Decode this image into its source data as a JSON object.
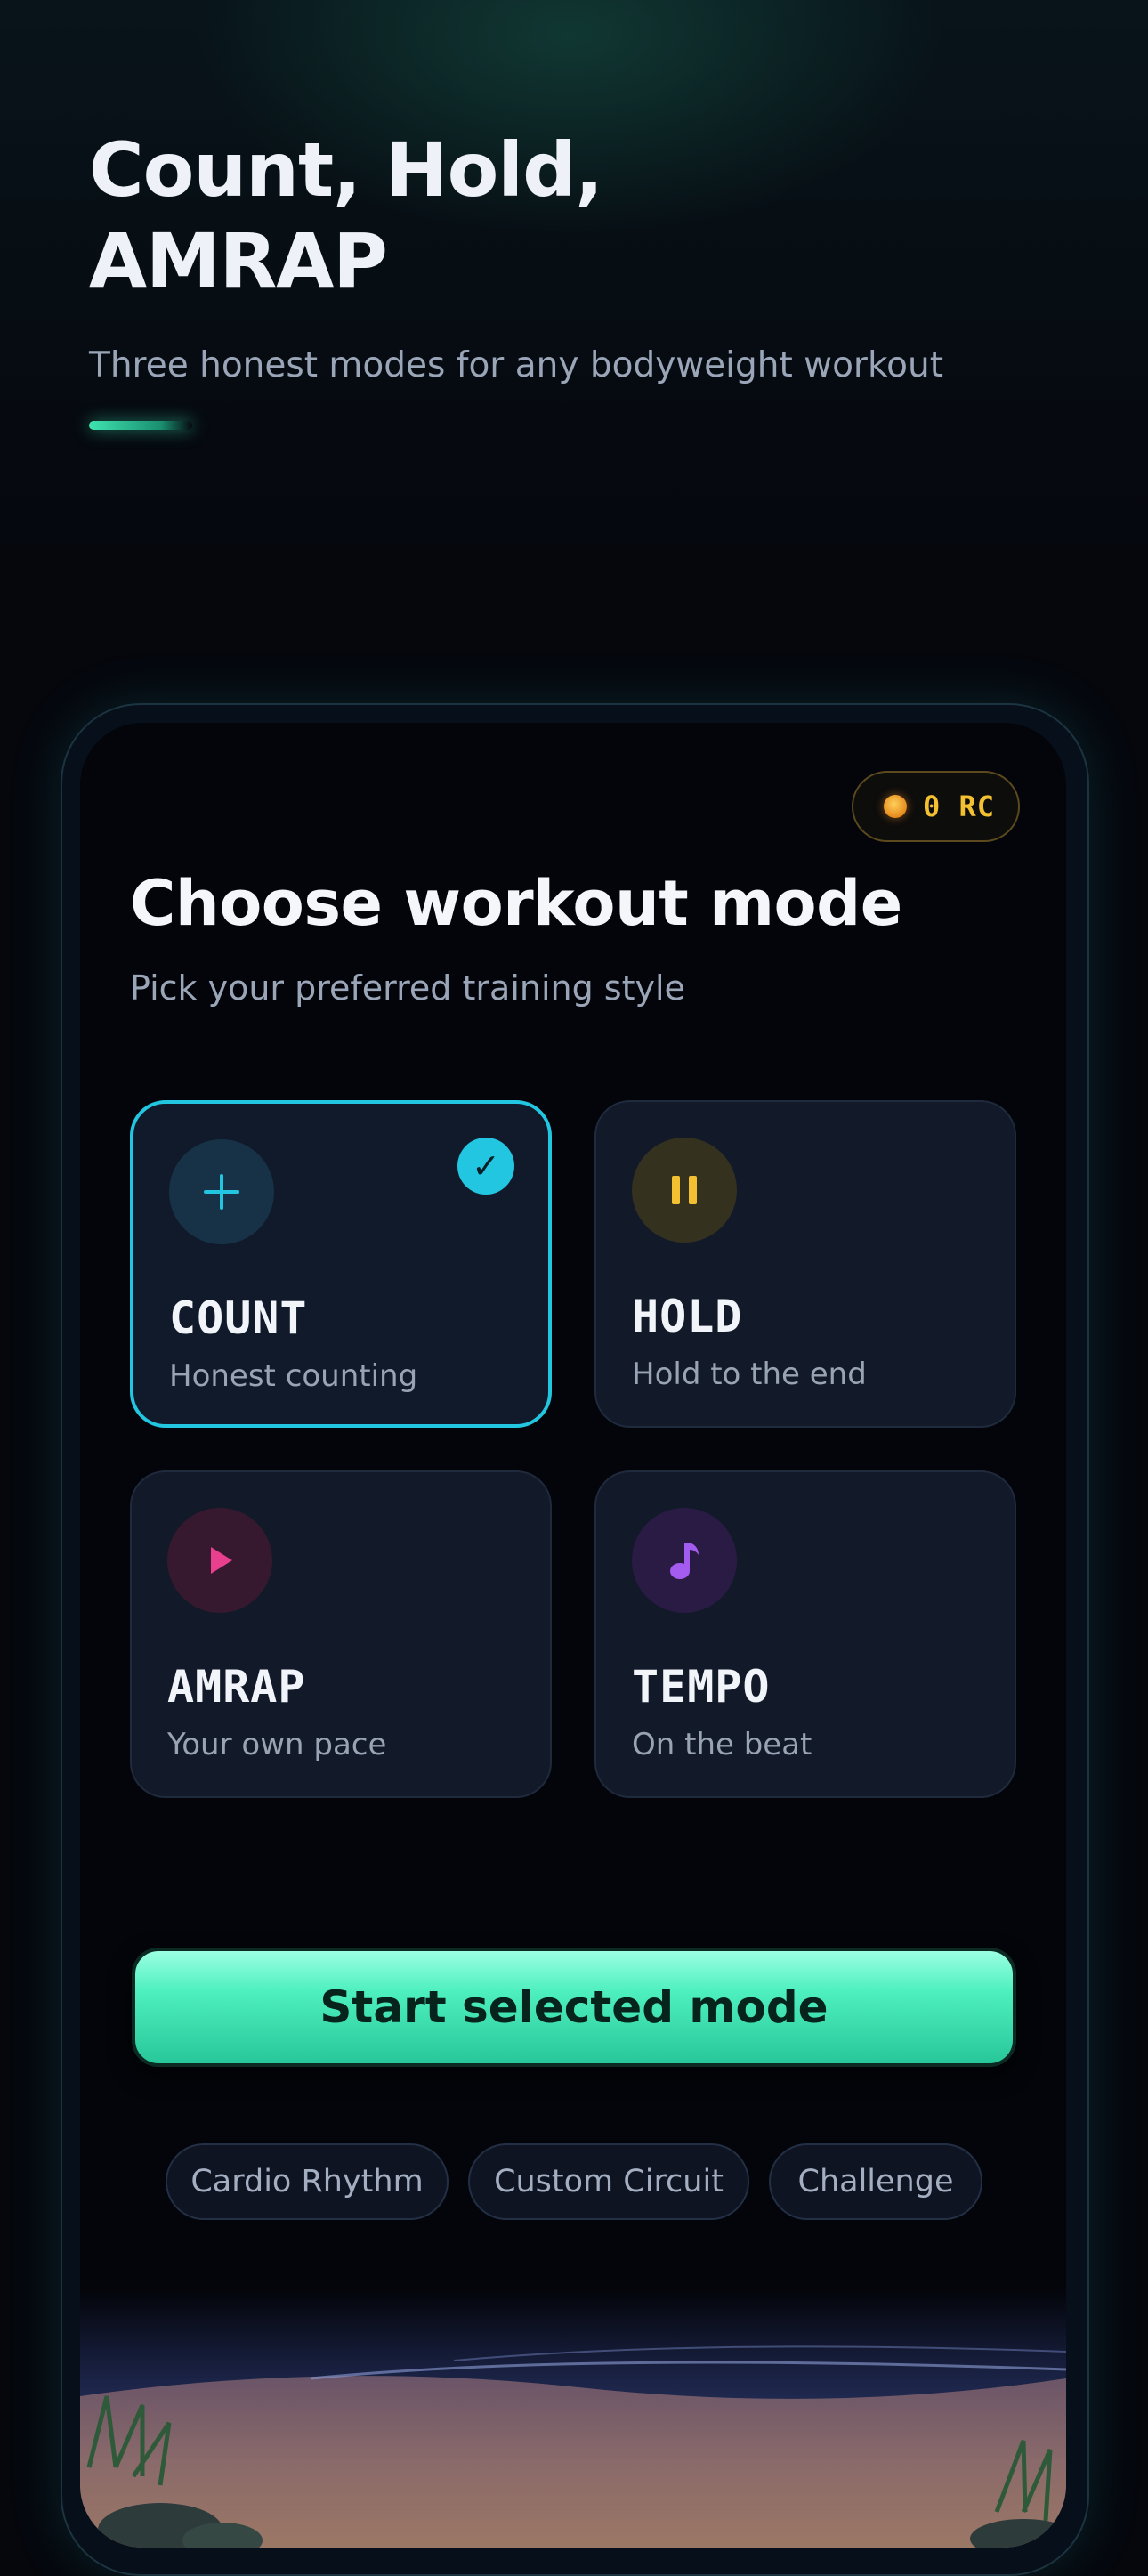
{
  "hero": {
    "title": "Count, Hold, AMRAP",
    "subtitle": "Three honest modes for any bodyweight workout"
  },
  "balance": {
    "value": "0 RC"
  },
  "screen": {
    "title": "Choose workout mode",
    "subtitle": "Pick your preferred training style"
  },
  "modes": [
    {
      "name": "COUNT",
      "description": "Honest counting",
      "icon": "plus-icon",
      "selected": true,
      "color": "#22c6e0"
    },
    {
      "name": "HOLD",
      "description": "Hold to the end",
      "icon": "pause-icon",
      "selected": false,
      "color": "#f2c030"
    },
    {
      "name": "AMRAP",
      "description": "Your own pace",
      "icon": "play-icon",
      "selected": false,
      "color": "#e83f8f"
    },
    {
      "name": "TEMPO",
      "description": "On the beat",
      "icon": "music-note-icon",
      "selected": false,
      "color": "#a45cf0"
    }
  ],
  "start_button": {
    "label": "Start selected mode"
  },
  "chips": [
    {
      "label": "Cardio Rhythm"
    },
    {
      "label": "Custom Circuit"
    },
    {
      "label": "Challenge"
    }
  ],
  "colors": {
    "accent": "#22c6e0",
    "primary_button": "#4ff0bf",
    "coin": "#f2c030"
  }
}
